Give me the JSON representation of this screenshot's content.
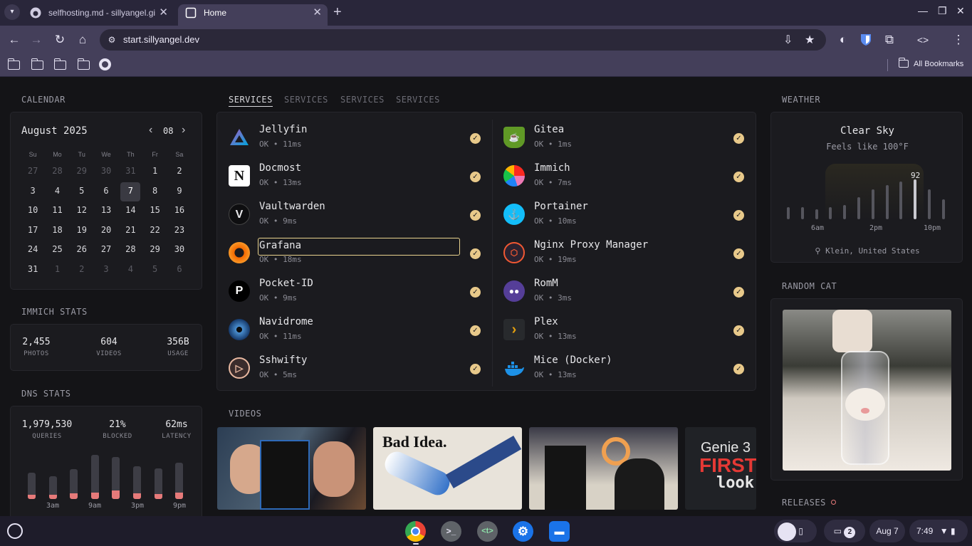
{
  "browser": {
    "tabs": [
      {
        "title": "selfhosting.md - sillyangel.github.io"
      },
      {
        "title": "Home"
      }
    ],
    "url": "start.sillyangel.dev",
    "all_bookmarks": "All Bookmarks"
  },
  "calendar": {
    "section": "CALENDAR",
    "month": "August 2025",
    "month_num": "08",
    "weekdays": [
      "Su",
      "Mo",
      "Tu",
      "We",
      "Th",
      "Fr",
      "Sa"
    ],
    "days": [
      "27",
      "28",
      "29",
      "30",
      "31",
      "1",
      "2",
      "3",
      "4",
      "5",
      "6",
      "7",
      "8",
      "9",
      "10",
      "11",
      "12",
      "13",
      "14",
      "15",
      "16",
      "17",
      "18",
      "19",
      "20",
      "21",
      "22",
      "23",
      "24",
      "25",
      "26",
      "27",
      "28",
      "29",
      "30",
      "31",
      "1",
      "2",
      "3",
      "4",
      "5",
      "6"
    ],
    "today": "7"
  },
  "immich": {
    "section": "IMMICH STATS",
    "photos": "2,455",
    "photos_label": "PHOTOS",
    "videos": "604",
    "videos_label": "VIDEOS",
    "usage": "356B",
    "usage_label": "USAGE"
  },
  "dns": {
    "section": "DNS STATS",
    "queries": "1,979,530",
    "queries_label": "QUERIES",
    "blocked": "21%",
    "blocked_label": "BLOCKED",
    "latency": "62ms",
    "latency_label": "LATENCY",
    "axis": [
      "3am",
      "9am",
      "3pm",
      "9pm"
    ]
  },
  "chart_data": {
    "type": "bar",
    "categories": [
      "",
      "3am",
      "",
      "9am",
      "",
      "3pm",
      "",
      "9pm"
    ],
    "series": [
      {
        "values": [
          0.6,
          0.52,
          0.68,
          1.0,
          0.95,
          0.75,
          0.7,
          0.82
        ]
      },
      {
        "values": [
          0.1,
          0.1,
          0.13,
          0.15,
          0.19,
          0.13,
          0.12,
          0.15
        ]
      }
    ],
    "xlabel": "",
    "ylabel": ""
  },
  "services": {
    "tabs": [
      "SERVICES",
      "SERVICES",
      "SERVICES",
      "SERVICES"
    ],
    "left": [
      {
        "name": "Jellyfin",
        "meta": "OK • 11ms"
      },
      {
        "name": "Docmost",
        "meta": "OK • 13ms"
      },
      {
        "name": "Vaultwarden",
        "meta": "OK • 9ms"
      },
      {
        "name": "Grafana",
        "meta": "OK • 18ms"
      },
      {
        "name": "Pocket-ID",
        "meta": "OK • 9ms"
      },
      {
        "name": "Navidrome",
        "meta": "OK • 11ms"
      },
      {
        "name": "Sshwifty",
        "meta": "OK • 5ms"
      }
    ],
    "right": [
      {
        "name": "Gitea",
        "meta": "OK • 1ms"
      },
      {
        "name": "Immich",
        "meta": "OK • 7ms"
      },
      {
        "name": "Portainer",
        "meta": "OK • 10ms"
      },
      {
        "name": "Nginx Proxy Manager",
        "meta": "OK • 19ms"
      },
      {
        "name": "RomM",
        "meta": "OK • 3ms"
      },
      {
        "name": "Plex",
        "meta": "OK • 13ms"
      },
      {
        "name": "Mice (Docker)",
        "meta": "OK • 13ms"
      }
    ]
  },
  "videos": {
    "section": "VIDEOS",
    "thumb2_text": "Bad Idea.",
    "thumb4_text": [
      "Genie 3",
      "FIRST",
      "look"
    ]
  },
  "weather": {
    "section": "WEATHER",
    "sky": "Clear Sky",
    "feels": "Feels like 100°F",
    "peak": "92",
    "axis": [
      "6am",
      "2pm",
      "10pm"
    ],
    "location": "Klein, United States",
    "hourly_levels": [
      0.3,
      0.3,
      0.25,
      0.3,
      0.35,
      0.55,
      0.75,
      0.85,
      0.95,
      1.0,
      0.75,
      0.5
    ]
  },
  "cat": {
    "section": "RANDOM CAT"
  },
  "releases": {
    "section": "RELEASES"
  },
  "shelf": {
    "date": "Aug 7",
    "time": "7:49",
    "notifications": "2"
  }
}
